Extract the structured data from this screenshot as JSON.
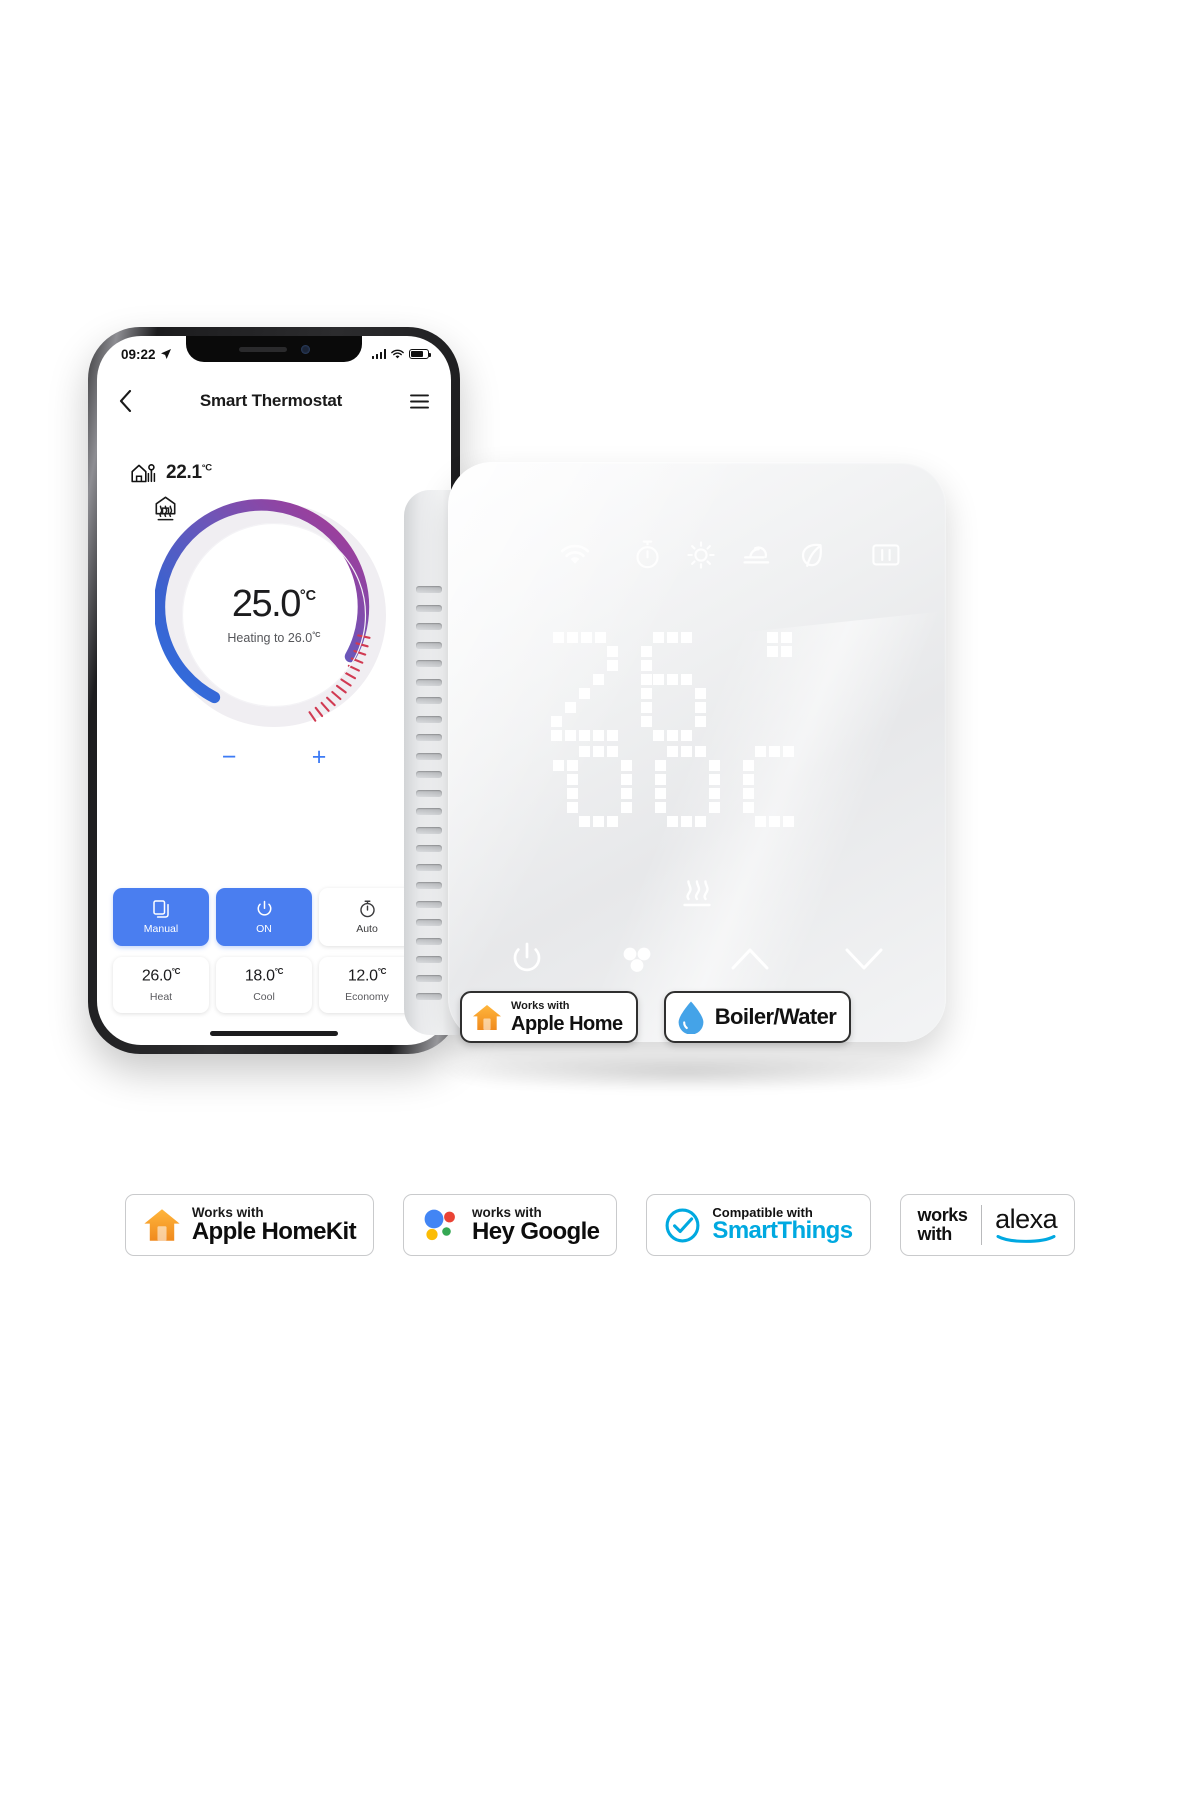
{
  "phone": {
    "status_bar": {
      "time": "09:22",
      "location_icon": "location-arrow-icon",
      "signal_icon": "cellular-bars-icon",
      "wifi_icon": "wifi-icon",
      "battery_icon": "battery-icon"
    },
    "nav": {
      "back_icon": "chevron-left-icon",
      "title": "Smart Thermostat",
      "menu_icon": "hamburger-menu-icon"
    },
    "ambient": {
      "icon": "home-sensor-icon",
      "value": "22.1",
      "unit": "°C"
    },
    "dial": {
      "home_icon": "home-icon",
      "temperature": "25.0",
      "unit": "°C",
      "status": "Heating to 26.0",
      "status_unit": "°C",
      "heating_icon": "heating-waves-icon",
      "minus_label": "−",
      "plus_label": "+",
      "gradient_start": "#2f6fe0",
      "gradient_mid": "#6d56b8",
      "gradient_end": "#b0398f",
      "tick_color": "#d13a52"
    },
    "modes": [
      {
        "label": "Manual",
        "icon": "card-stack-icon",
        "active": true
      },
      {
        "label": "ON",
        "icon": "power-icon",
        "active": true
      },
      {
        "label": "Auto",
        "icon": "timer-icon",
        "active": false
      }
    ],
    "presets": [
      {
        "value": "26.0",
        "unit": "°C",
        "label": "Heat"
      },
      {
        "value": "18.0",
        "unit": "°C",
        "label": "Cool"
      },
      {
        "value": "12.0",
        "unit": "°C",
        "label": "Economy"
      }
    ],
    "accent_color": "#4a7ef0"
  },
  "device": {
    "top_icons": [
      "wifi-icon",
      "timer-icon",
      "comfort-sun-icon",
      "sleep-mode-icon",
      "eco-leaf-icon",
      "screen-lock-icon"
    ],
    "led_reading": "26.0",
    "led_unit": "°C",
    "heating_icon": "heating-waves-icon",
    "controls": [
      "power-icon",
      "fan-icon",
      "chevron-up-icon",
      "chevron-down-icon"
    ],
    "badges": [
      {
        "icon": "apple-home-icon",
        "small": "Works with",
        "big": "Apple Home"
      },
      {
        "icon": "water-drop-icon",
        "single": "Boiler/Water"
      }
    ]
  },
  "certifications": [
    {
      "icon": "apple-homekit-icon",
      "small": "Works with",
      "big": "Apple HomeKit"
    },
    {
      "icon": "google-assistant-icon",
      "small": "works with",
      "big": "Hey Google"
    },
    {
      "icon": "smartthings-check-icon",
      "small": "Compatible with",
      "big": "SmartThings"
    },
    {
      "icon": "alexa-icon",
      "line1": "works",
      "line2": "with",
      "brand": "alexa"
    }
  ]
}
